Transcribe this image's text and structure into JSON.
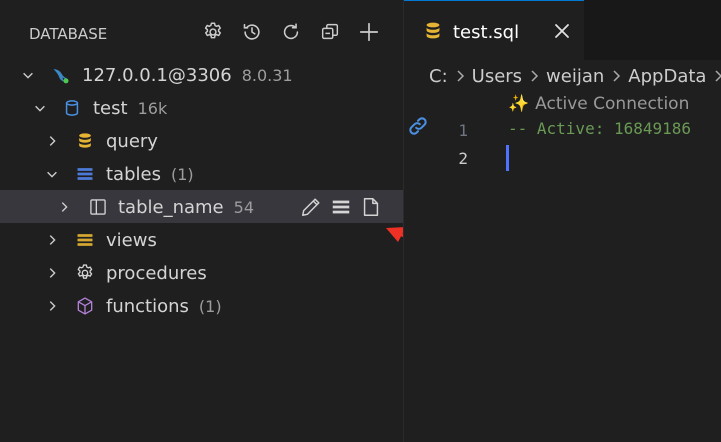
{
  "sidebar": {
    "title": "DATABASE",
    "actions": [
      {
        "name": "settings-icon"
      },
      {
        "name": "history-icon"
      },
      {
        "name": "refresh-icon"
      },
      {
        "name": "collapse-all-icon"
      },
      {
        "name": "add-connection-icon"
      }
    ],
    "tree": {
      "connection": {
        "label": "127.0.0.1@3306",
        "version": "8.0.31"
      },
      "database": {
        "label": "test",
        "size": "16k"
      },
      "query": {
        "label": "query"
      },
      "tables": {
        "label": "tables",
        "count": "(1)"
      },
      "table": {
        "label": "table_name",
        "count": "54"
      },
      "views": {
        "label": "views"
      },
      "procedures": {
        "label": "procedures"
      },
      "functions": {
        "label": "functions",
        "count": "(1)"
      }
    }
  },
  "editor": {
    "tab": {
      "label": "test.sql"
    },
    "breadcrumb": [
      "C:",
      "Users",
      "weijan",
      "AppData"
    ],
    "codelens": {
      "label": "Active Connection"
    },
    "lines": [
      {
        "number": "1",
        "text": "-- Active: 16849186"
      },
      {
        "number": "2",
        "text": ""
      }
    ]
  },
  "colors": {
    "sidebar_bg": "#1f1f1f",
    "selected_row_bg": "#37373d",
    "mysql_dolphin": "#3b88c3",
    "db_cylinder": "#4a90e2",
    "query_icon": "#e5b434",
    "tables_icon": "#4d79d8",
    "views_icon": "#d4a632",
    "functions_icon": "#b180d7",
    "comment_green": "#6a9955",
    "cursor_blue": "#4e74ff",
    "annotation_arrow": "#ee3124"
  }
}
